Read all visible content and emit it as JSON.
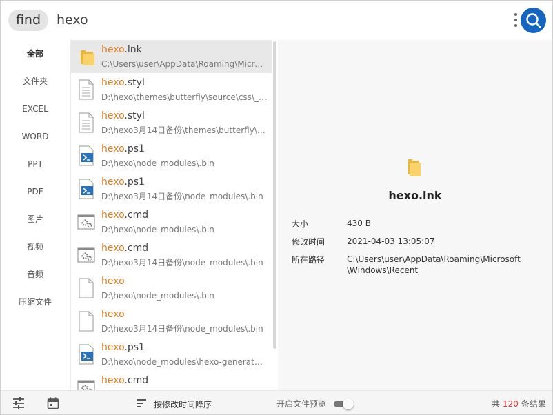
{
  "search": {
    "mode_label": "find",
    "query": "hexo"
  },
  "sidebar": {
    "items": [
      {
        "label": "全部",
        "active": true
      },
      {
        "label": "文件夹"
      },
      {
        "label": "EXCEL"
      },
      {
        "label": "WORD"
      },
      {
        "label": "PPT"
      },
      {
        "label": "PDF"
      },
      {
        "label": "图片"
      },
      {
        "label": "视频"
      },
      {
        "label": "音频"
      },
      {
        "label": "压缩文件"
      }
    ]
  },
  "results": [
    {
      "icon": "folder-icon",
      "match": "hexo",
      "ext": ".lnk",
      "path": "C:\\Users\\user\\AppData\\Roaming\\Micro...",
      "selected": true
    },
    {
      "icon": "text-file-icon",
      "match": "hexo",
      "ext": ".styl",
      "path": "D:\\hexo\\themes\\butterfly\\source\\css\\_t..."
    },
    {
      "icon": "text-file-icon",
      "match": "hexo",
      "ext": ".styl",
      "path": "D:\\hexo3月14日备份\\themes\\butterfly\\s..."
    },
    {
      "icon": "powershell-icon",
      "match": "hexo",
      "ext": ".ps1",
      "path": "D:\\hexo\\node_modules\\.bin"
    },
    {
      "icon": "powershell-icon",
      "match": "hexo",
      "ext": ".ps1",
      "path": "D:\\hexo3月14日备份\\node_modules\\.bin"
    },
    {
      "icon": "cmd-gear-icon",
      "match": "hexo",
      "ext": ".cmd",
      "path": "D:\\hexo\\node_modules\\.bin"
    },
    {
      "icon": "cmd-gear-icon",
      "match": "hexo",
      "ext": ".cmd",
      "path": "D:\\hexo3月14日备份\\node_modules\\.bin"
    },
    {
      "icon": "blank-file-icon",
      "match": "hexo",
      "ext": "",
      "path": "D:\\hexo\\node_modules\\.bin"
    },
    {
      "icon": "blank-file-icon",
      "match": "hexo",
      "ext": "",
      "path": "D:\\hexo3月14日备份\\node_modules\\.bin"
    },
    {
      "icon": "powershell-icon",
      "match": "hexo",
      "ext": ".ps1",
      "path": "D:\\hexo\\node_modules\\hexo-generato..."
    },
    {
      "icon": "cmd-gear-icon",
      "match": "hexo",
      "ext": ".cmd",
      "path": ""
    }
  ],
  "detail": {
    "icon": "folder-icon",
    "name": "hexo.lnk",
    "size_label": "大小",
    "size_value": "430 B",
    "modified_label": "修改时间",
    "modified_value": "2021-04-03 13:05:07",
    "path_label": "所在路径",
    "path_value": "C:\\Users\\user\\AppData\\Roaming\\Microsoft\\Windows\\Recent"
  },
  "bottombar": {
    "sort_label": "按修改时间降序",
    "preview_label": "开启文件预览",
    "preview_on": true,
    "count_prefix": "共",
    "count_value": "120",
    "count_suffix": "条结果"
  },
  "colors": {
    "accent": "#1565c0",
    "highlight": "#e37c1e",
    "count": "#e53935"
  }
}
